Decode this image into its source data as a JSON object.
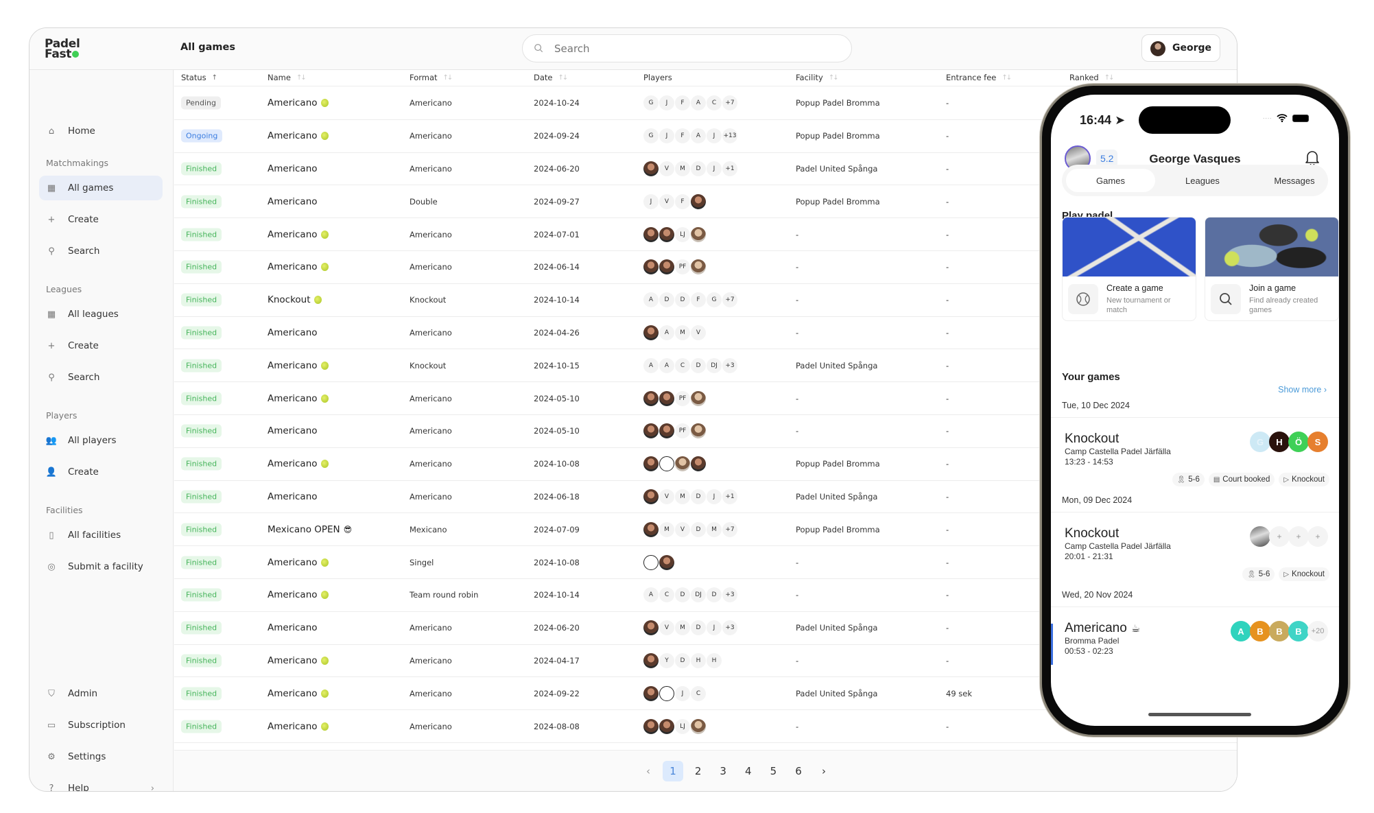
{
  "app": {
    "logo_line1": "Padel",
    "logo_line2": "Fast",
    "page_title": "All games"
  },
  "search": {
    "placeholder": "Search"
  },
  "user": {
    "name": "George"
  },
  "sidebar": {
    "home": "Home",
    "sections": [
      {
        "title": "Matchmakings",
        "items": [
          "All games",
          "Create",
          "Search"
        ]
      },
      {
        "title": "Leagues",
        "items": [
          "All leagues",
          "Create",
          "Search"
        ]
      },
      {
        "title": "Players",
        "items": [
          "All players",
          "Create"
        ]
      },
      {
        "title": "Facilities",
        "items": [
          "All facilities",
          "Submit a facility"
        ]
      }
    ],
    "bottom": [
      "Admin",
      "Subscription",
      "Settings",
      "Help"
    ],
    "active": "All games"
  },
  "table": {
    "columns": [
      "Status",
      "Name",
      "Format",
      "Date",
      "Players",
      "Facility",
      "Entrance fee",
      "Ranked"
    ],
    "sorted_column": "Status",
    "rows": [
      {
        "status": "Pending",
        "name": "Americano",
        "icon": "ball",
        "format": "Americano",
        "date": "2024-10-24",
        "players": [
          "G",
          "J",
          "F",
          "A",
          "C",
          "+7"
        ],
        "facility": "Popup Padel Bromma",
        "fee": "-"
      },
      {
        "status": "Ongoing",
        "name": "Americano",
        "icon": "ball",
        "format": "Americano",
        "date": "2024-09-24",
        "players": [
          "G",
          "J",
          "F",
          "A",
          "J",
          "+13"
        ],
        "facility": "Popup Padel Bromma",
        "fee": "-"
      },
      {
        "status": "Finished",
        "name": "Americano",
        "icon": "",
        "format": "Americano",
        "date": "2024-06-20",
        "players": [
          "@photo",
          "V",
          "M",
          "D",
          "J",
          "+1"
        ],
        "facility": "Padel United Spånga",
        "fee": "-"
      },
      {
        "status": "Finished",
        "name": "Americano",
        "icon": "",
        "format": "Double",
        "date": "2024-09-27",
        "players": [
          "J",
          "V",
          "F",
          "@photo"
        ],
        "facility": "Popup Padel Bromma",
        "fee": "-"
      },
      {
        "status": "Finished",
        "name": "Americano",
        "icon": "ball",
        "format": "Americano",
        "date": "2024-07-01",
        "players": [
          "@photo",
          "@photo",
          "LJ",
          "@photo2"
        ],
        "facility": "-",
        "fee": "-"
      },
      {
        "status": "Finished",
        "name": "Americano",
        "icon": "ball",
        "format": "Americano",
        "date": "2024-06-14",
        "players": [
          "@photo",
          "@photo",
          "PF",
          "@photo2"
        ],
        "facility": "-",
        "fee": "-"
      },
      {
        "status": "Finished",
        "name": "Knockout",
        "icon": "ball",
        "format": "Knockout",
        "date": "2024-10-14",
        "players": [
          "A",
          "D",
          "D",
          "F",
          "G",
          "+7"
        ],
        "facility": "-",
        "fee": "-"
      },
      {
        "status": "Finished",
        "name": "Americano",
        "icon": "",
        "format": "Americano",
        "date": "2024-04-26",
        "players": [
          "@photo",
          "A",
          "M",
          "V"
        ],
        "facility": "-",
        "fee": "-"
      },
      {
        "status": "Finished",
        "name": "Americano",
        "icon": "ball",
        "format": "Knockout",
        "date": "2024-10-15",
        "players": [
          "A",
          "A",
          "C",
          "D",
          "DJ",
          "+3"
        ],
        "facility": "Padel United Spånga",
        "fee": "-"
      },
      {
        "status": "Finished",
        "name": "Americano",
        "icon": "ball",
        "format": "Americano",
        "date": "2024-05-10",
        "players": [
          "@photo",
          "@photo",
          "PF",
          "@photo2"
        ],
        "facility": "-",
        "fee": "-"
      },
      {
        "status": "Finished",
        "name": "Americano",
        "icon": "",
        "format": "Americano",
        "date": "2024-05-10",
        "players": [
          "@photo",
          "@photo",
          "PF",
          "@photo2"
        ],
        "facility": "-",
        "fee": "-"
      },
      {
        "status": "Finished",
        "name": "Americano",
        "icon": "ball",
        "format": "Americano",
        "date": "2024-10-08",
        "players": [
          "@photo",
          "@ball",
          "@photo2",
          "@photo"
        ],
        "facility": "Popup Padel Bromma",
        "fee": "-"
      },
      {
        "status": "Finished",
        "name": "Americano",
        "icon": "",
        "format": "Americano",
        "date": "2024-06-18",
        "players": [
          "@photo",
          "V",
          "M",
          "D",
          "J",
          "+1"
        ],
        "facility": "Padel United Spånga",
        "fee": "-"
      },
      {
        "status": "Finished",
        "name": "Mexicano OPEN",
        "icon": "sunglasses",
        "format": "Mexicano",
        "date": "2024-07-09",
        "players": [
          "@photo",
          "M",
          "V",
          "D",
          "M",
          "+7"
        ],
        "facility": "Popup Padel Bromma",
        "fee": "-"
      },
      {
        "status": "Finished",
        "name": "Americano",
        "icon": "ball",
        "format": "Singel",
        "date": "2024-10-08",
        "players": [
          "@ball",
          "@photo"
        ],
        "facility": "-",
        "fee": "-"
      },
      {
        "status": "Finished",
        "name": "Americano",
        "icon": "ball",
        "format": "Team round robin",
        "date": "2024-10-14",
        "players": [
          "A",
          "C",
          "D",
          "DJ",
          "D",
          "+3"
        ],
        "facility": "-",
        "fee": "-"
      },
      {
        "status": "Finished",
        "name": "Americano",
        "icon": "",
        "format": "Americano",
        "date": "2024-06-20",
        "players": [
          "@photo",
          "V",
          "M",
          "D",
          "J",
          "+3"
        ],
        "facility": "Padel United Spånga",
        "fee": "-"
      },
      {
        "status": "Finished",
        "name": "Americano",
        "icon": "ball",
        "format": "Americano",
        "date": "2024-04-17",
        "players": [
          "@photo",
          "Y",
          "D",
          "H",
          "H"
        ],
        "facility": "-",
        "fee": "-"
      },
      {
        "status": "Finished",
        "name": "Americano",
        "icon": "ball",
        "format": "Americano",
        "date": "2024-09-22",
        "players": [
          "@photo",
          "@ball",
          "J",
          "C"
        ],
        "facility": "Padel United Spånga",
        "fee": "49 sek"
      },
      {
        "status": "Finished",
        "name": "Americano",
        "icon": "ball",
        "format": "Americano",
        "date": "2024-08-08",
        "players": [
          "@photo",
          "@photo",
          "LJ",
          "@photo2"
        ],
        "facility": "-",
        "fee": "-"
      }
    ]
  },
  "pagination": {
    "pages": [
      "1",
      "2",
      "3",
      "4",
      "5",
      "6"
    ],
    "current": "1",
    "prev": "‹",
    "next": "›"
  },
  "phone": {
    "time": "16:44",
    "rating": "5.2",
    "user_name": "George Vasques",
    "tabs": [
      "Games",
      "Leagues",
      "Messages"
    ],
    "active_tab": "Games",
    "play_title": "Play padel",
    "cards": [
      {
        "title": "Create a game",
        "subtitle": "New tournament or match"
      },
      {
        "title": "Join a game",
        "subtitle": "Find already created games"
      }
    ],
    "your_games_title": "Your games",
    "show_more": "Show more",
    "games": [
      {
        "date": "Tue, 10 Dec 2024",
        "title": "Knockout",
        "emoji": "",
        "place": "Camp Castella Padel Järfälla",
        "time": "13:23 - 14:53",
        "avatars": [
          {
            "l": "G",
            "c": "#cde9f5"
          },
          {
            "l": "H",
            "c": "#2a120c"
          },
          {
            "l": "Ö",
            "c": "#3fd057"
          },
          {
            "l": "S",
            "c": "#e67f2e"
          }
        ],
        "tags": [
          "5-6",
          "Court booked",
          "Knockout"
        ]
      },
      {
        "date": "Mon, 09 Dec 2024",
        "title": "Knockout",
        "emoji": "",
        "place": "Camp Castella Padel Järfälla",
        "time": "20:01 - 21:31",
        "avatars": [
          {
            "l": "",
            "c": "#888"
          },
          {
            "l": "+",
            "c": "#f4f4f4"
          },
          {
            "l": "+",
            "c": "#f4f4f4"
          },
          {
            "l": "+",
            "c": "#f4f4f4"
          }
        ],
        "tags": [
          "5-6",
          "Knockout"
        ]
      },
      {
        "date": "Wed, 20 Nov 2024",
        "title": "Americano",
        "emoji": "☕",
        "place": "Bromma Padel",
        "time": "00:53 - 02:23",
        "avatars": [
          {
            "l": "A",
            "c": "#2fd3bd"
          },
          {
            "l": "B",
            "c": "#e6921f"
          },
          {
            "l": "B",
            "c": "#c9aa5d"
          },
          {
            "l": "B",
            "c": "#3fd4c6"
          },
          {
            "l": "+20",
            "c": "#f4f4f4"
          }
        ],
        "tags": []
      }
    ]
  }
}
